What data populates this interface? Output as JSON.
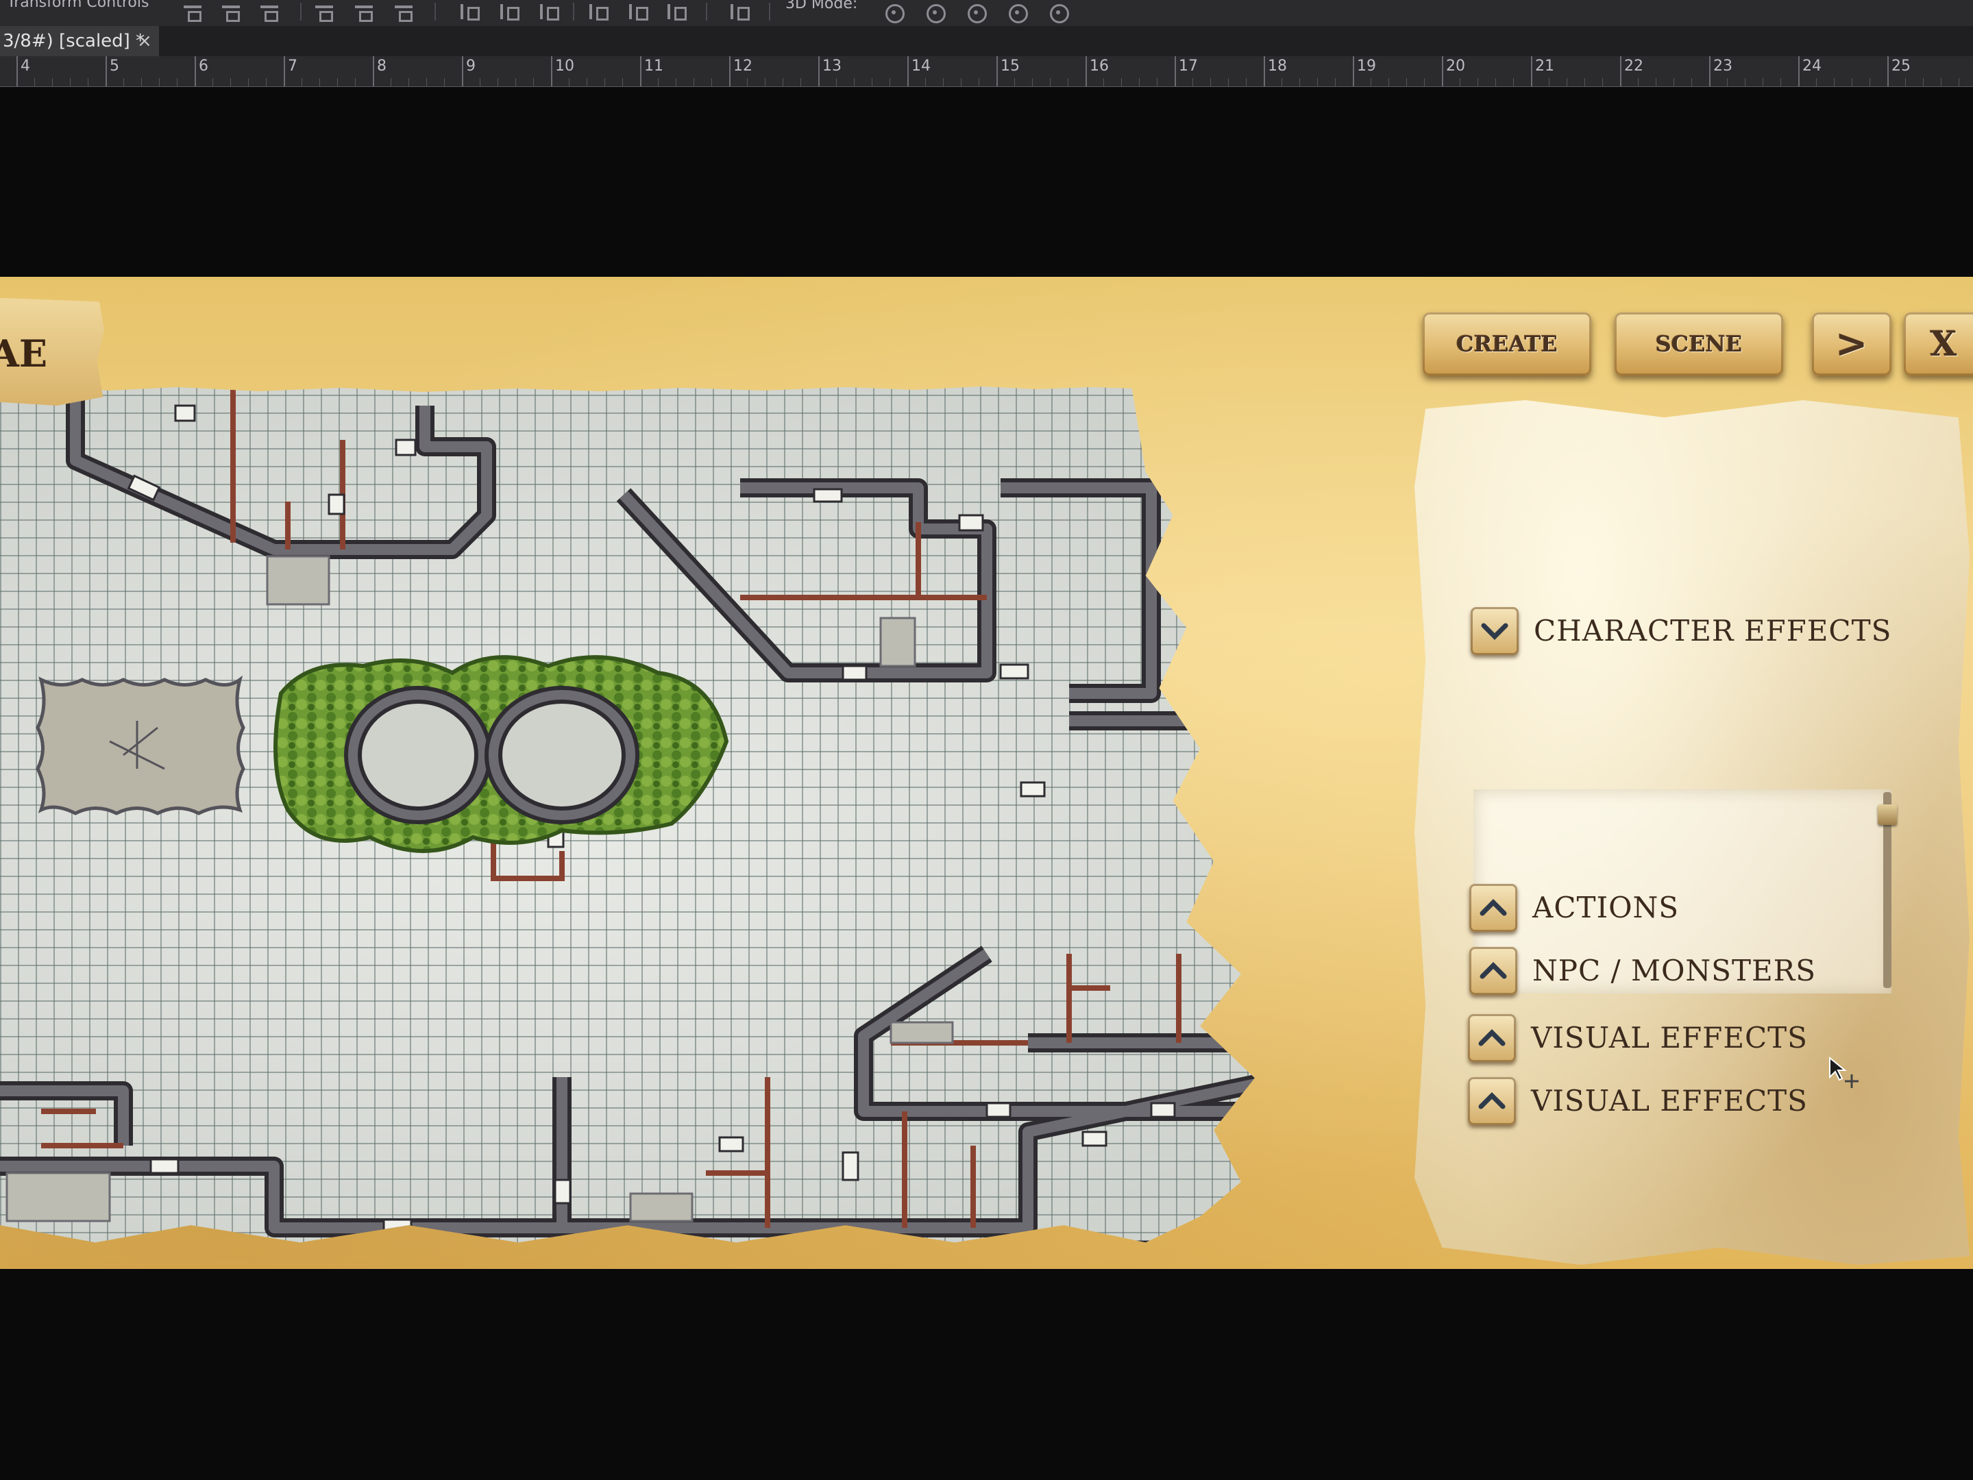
{
  "editor": {
    "toolbar_label": "Transform Controls",
    "mode_label": "3D Mode:",
    "document_tab": "3/8#) [scaled] *",
    "tab_close": "×",
    "ruler_numbers": [
      "4",
      "5",
      "6",
      "7",
      "8",
      "9",
      "10",
      "11",
      "12",
      "13",
      "14",
      "15",
      "16",
      "17",
      "18",
      "19",
      "20",
      "21",
      "22",
      "23",
      "24",
      "25"
    ]
  },
  "game": {
    "title_tab_text": "AE",
    "buttons": {
      "create": "CREATE",
      "scene": "SCENE",
      "next": ">",
      "close": "X"
    },
    "panel": {
      "sections": [
        {
          "label": "CHARACTER EFFECTS",
          "expanded": true
        },
        {
          "label": "ACTIONS",
          "expanded": false
        },
        {
          "label": "NPC / MONSTERS",
          "expanded": false
        },
        {
          "label": "VISUAL EFFECTS",
          "expanded": false
        },
        {
          "label": "VISUAL EFFECTS",
          "expanded": false
        }
      ]
    },
    "map": {
      "grid": true,
      "colors": {
        "wall": "#55535a",
        "wall_dark": "#2e2c31",
        "door": "#efefe9",
        "floor_line": "#8a4230",
        "foliage": "#5f8d2e",
        "water": "#c4c7c1"
      }
    }
  }
}
